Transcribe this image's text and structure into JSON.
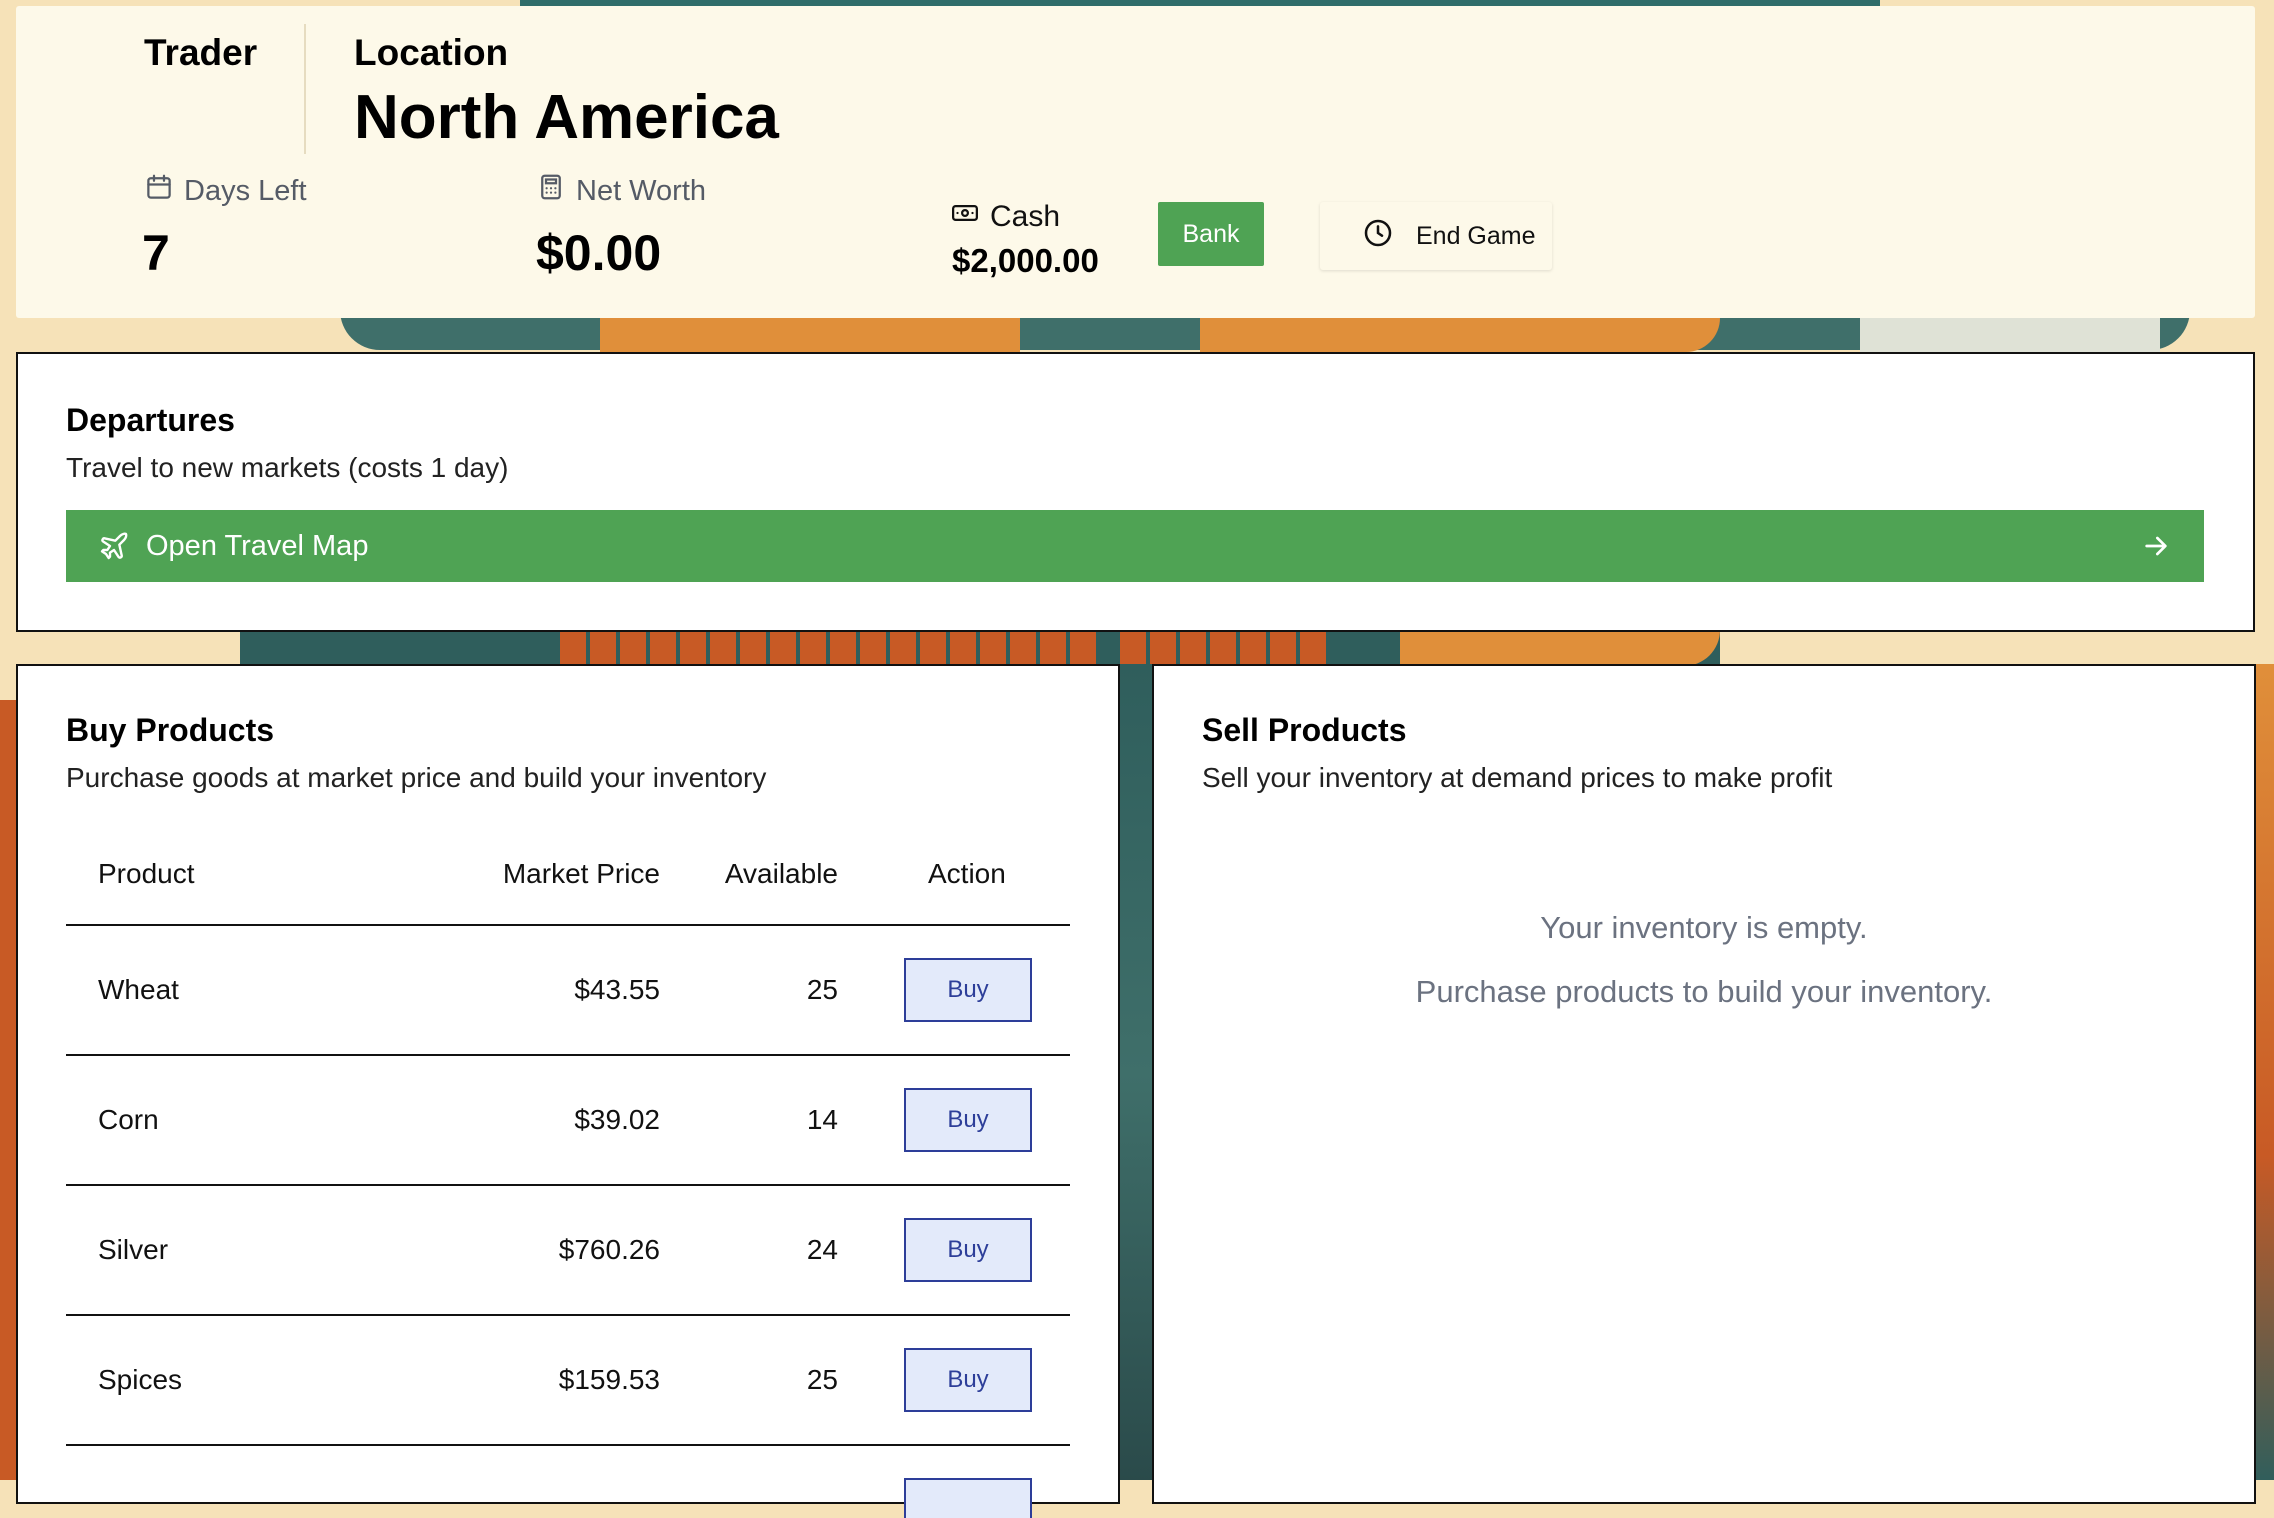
{
  "header": {
    "trader_label": "Trader",
    "location_label": "Location",
    "location_name": "North America",
    "days_left_label": "Days Left",
    "days_left_value": "7",
    "net_worth_label": "Net Worth",
    "net_worth_value": "$0.00",
    "cash_label": "Cash",
    "cash_value": "$2,000.00",
    "bank_label": "Bank",
    "end_game_label": "End Game"
  },
  "departures": {
    "title": "Departures",
    "subtitle": "Travel to new markets (costs 1 day)",
    "travel_button_label": "Open Travel Map"
  },
  "buy": {
    "title": "Buy Products",
    "subtitle": "Purchase goods at market price and build your inventory",
    "columns": [
      "Product",
      "Market Price",
      "Available",
      "Action"
    ],
    "rows": [
      {
        "product": "Wheat",
        "price": "$43.55",
        "available": "25",
        "action": "Buy"
      },
      {
        "product": "Corn",
        "price": "$39.02",
        "available": "14",
        "action": "Buy"
      },
      {
        "product": "Silver",
        "price": "$760.26",
        "available": "24",
        "action": "Buy"
      },
      {
        "product": "Spices",
        "price": "$159.53",
        "available": "25",
        "action": "Buy"
      }
    ]
  },
  "sell": {
    "title": "Sell Products",
    "subtitle": "Sell your inventory at demand prices to make profit",
    "empty_line1": "Your inventory is empty.",
    "empty_line2": "Purchase products to build your inventory."
  },
  "colors": {
    "accent_green": "#4fa354",
    "buy_button_blue": "#2d3e99",
    "header_bg": "#fdf9e9",
    "page_bg": "#f6e2b8"
  }
}
